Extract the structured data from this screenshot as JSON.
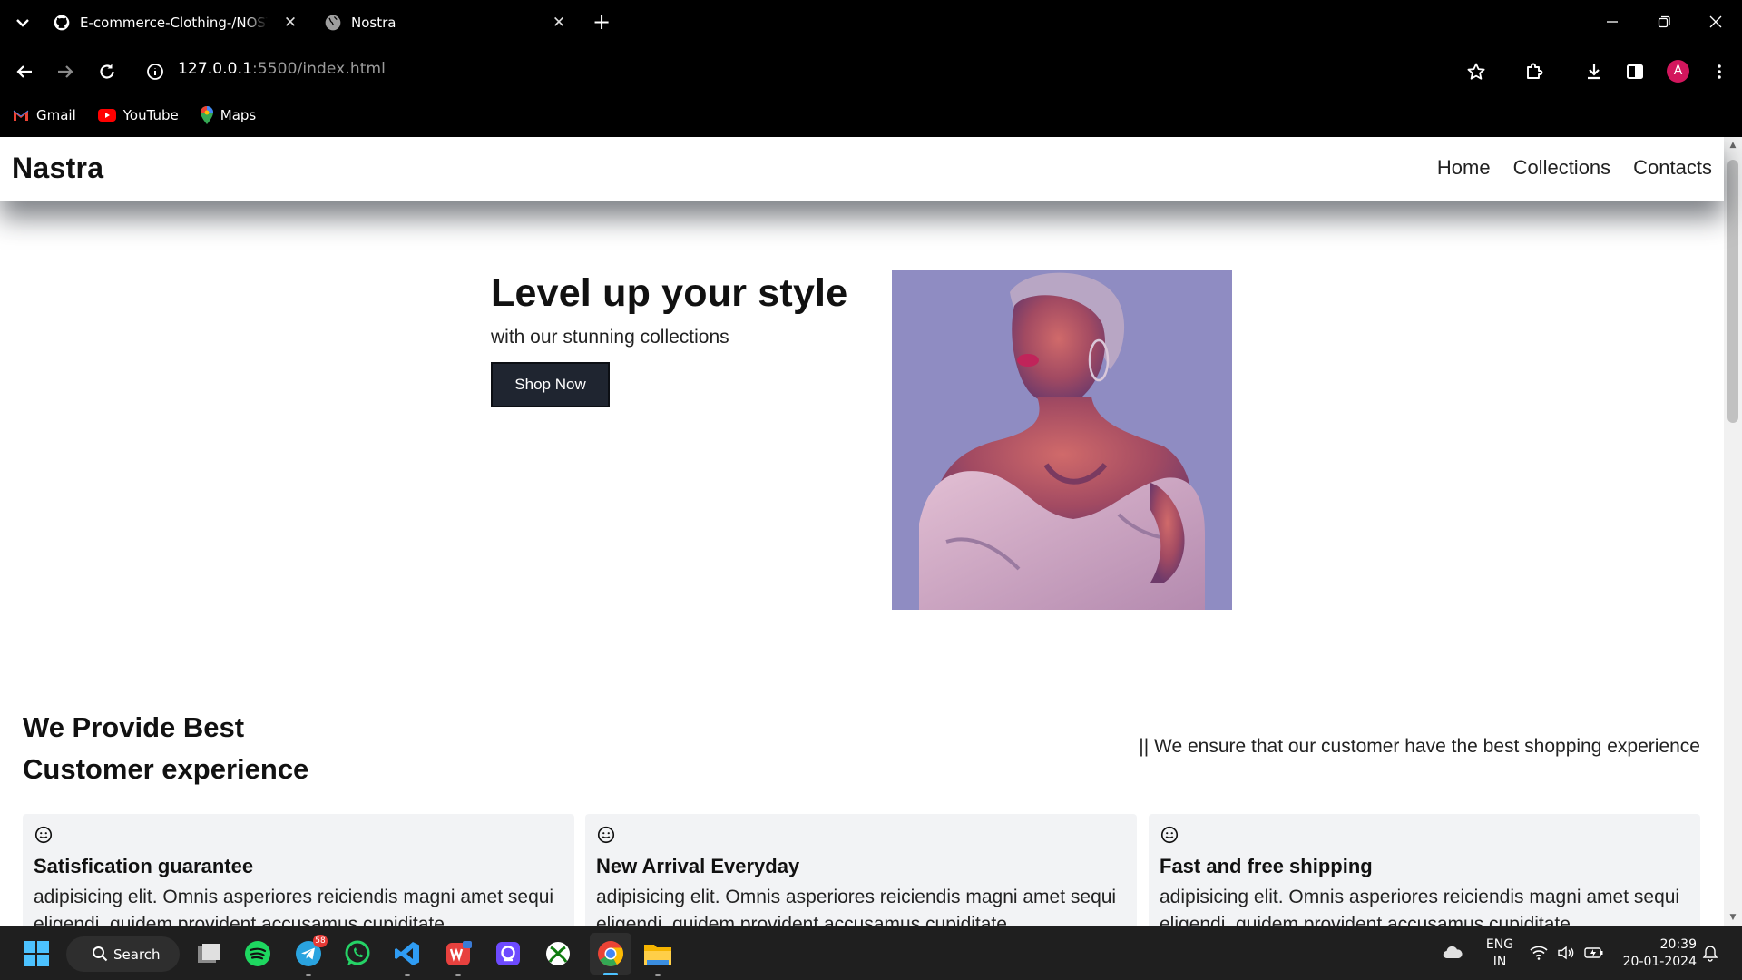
{
  "browser": {
    "tabs": [
      {
        "title": "E-commerce-Clothing-/NOSTRA",
        "active": false
      },
      {
        "title": "Nostra",
        "active": true
      }
    ],
    "url": {
      "host": "127.0.0.1",
      "rest": ":5500/index.html"
    },
    "profile_initial": "A",
    "bookmarks": [
      {
        "label": "Gmail"
      },
      {
        "label": "YouTube"
      },
      {
        "label": "Maps"
      }
    ]
  },
  "site": {
    "brand": "Nastra",
    "nav": [
      "Home",
      "Collections",
      "Contacts"
    ],
    "hero": {
      "title": "Level up your style",
      "subtitle": "with our stunning collections",
      "cta": "Shop Now"
    },
    "section": {
      "title_line1": "We Provide Best",
      "title_line2": "Customer experience",
      "side_text": "|| We ensure that our customer have the best shopping experience"
    },
    "cards": [
      {
        "title": "Satisfication guarantee",
        "text": "adipisicing elit. Omnis asperiores reiciendis magni amet sequi eligendi, quidem provident accusamus cupiditate"
      },
      {
        "title": "New Arrival Everyday",
        "text": "adipisicing elit. Omnis asperiores reiciendis magni amet sequi eligendi, quidem provident accusamus cupiditate"
      },
      {
        "title": "Fast and free shipping",
        "text": "adipisicing elit. Omnis asperiores reiciendis magni amet sequi eligendi, quidem provident accusamus cupiditate"
      }
    ]
  },
  "taskbar": {
    "search_label": "Search",
    "telegram_badge": "58",
    "lang_line1": "ENG",
    "lang_line2": "IN",
    "time": "20:39",
    "date": "20-01-2024"
  },
  "colors": {
    "chrome_bg": "#000000",
    "button_bg": "#1f2530",
    "card_bg": "#f2f3f5",
    "avatar": "#d3165d"
  }
}
